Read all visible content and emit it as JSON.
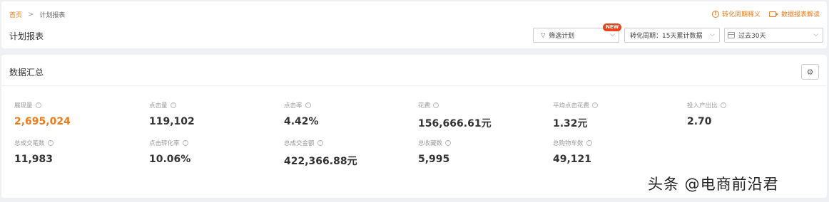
{
  "breadcrumb": {
    "home": "首页",
    "separator": ">",
    "current": "计划报表"
  },
  "page_title": "计划报表",
  "top_links": [
    {
      "label": "转化周期释义",
      "icon": "info-circle-icon"
    },
    {
      "label": "数据报表解读",
      "icon": "video-icon"
    }
  ],
  "filter": {
    "label": "筛选计划",
    "badge": "NEW",
    "icon": "funnel-icon"
  },
  "period_select": {
    "value": "转化周期：15天累计数据"
  },
  "date_select": {
    "value": "过去30天",
    "icon": "calendar-icon"
  },
  "summary": {
    "title": "数据汇总",
    "settings_icon": "gear-icon",
    "metrics": [
      {
        "label": "展现量",
        "value": "2,695,024",
        "highlight": true
      },
      {
        "label": "点击量",
        "value": "119,102"
      },
      {
        "label": "点击率",
        "value": "4.42%"
      },
      {
        "label": "花费",
        "value": "156,666.61元"
      },
      {
        "label": "平均点击花费",
        "value": "1.32元"
      },
      {
        "label": "投入产出比",
        "value": "2.70"
      },
      {
        "label": "总成交笔数",
        "value": "11,983"
      },
      {
        "label": "点击转化率",
        "value": "10.06%"
      },
      {
        "label": "总成交金额",
        "value": "422,366.88元"
      },
      {
        "label": "总收藏数",
        "value": "5,995"
      },
      {
        "label": "总购物车数",
        "value": "49,121"
      }
    ]
  },
  "watermark": "头条 @电商前沿君",
  "colors": {
    "accent": "#f07b1a",
    "badge": "#e8441f"
  }
}
